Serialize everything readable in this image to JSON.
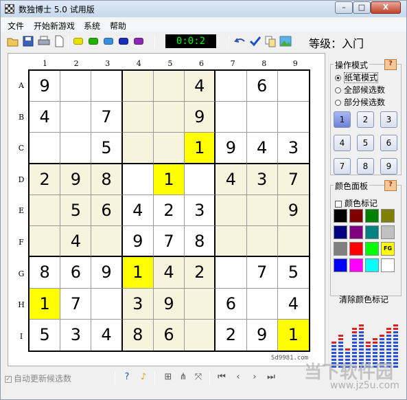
{
  "window": {
    "title": "数独博士 5.0 试用版",
    "min": "–",
    "max": "□",
    "close": "X"
  },
  "menu": [
    "文件",
    "开始新游戏",
    "系统",
    "帮助"
  ],
  "timer": "0:0:2",
  "level": "等级：入门",
  "board": {
    "cols": [
      "1",
      "2",
      "3",
      "4",
      "5",
      "6",
      "7",
      "8",
      "9"
    ],
    "rows": [
      "A",
      "B",
      "C",
      "D",
      "E",
      "F",
      "G",
      "H",
      "I"
    ],
    "cells": [
      [
        "9",
        "",
        "",
        "",
        "",
        "4",
        "",
        "6",
        ""
      ],
      [
        "4",
        "",
        "7",
        "",
        "",
        "9",
        "",
        "",
        ""
      ],
      [
        "",
        "",
        "5",
        "",
        "",
        "1",
        "9",
        "4",
        "3"
      ],
      [
        "2",
        "9",
        "8",
        "",
        "1",
        "",
        "4",
        "3",
        "7"
      ],
      [
        "",
        "5",
        "6",
        "4",
        "2",
        "3",
        "",
        "",
        "9"
      ],
      [
        "",
        "4",
        "",
        "9",
        "7",
        "8",
        "",
        "",
        ""
      ],
      [
        "8",
        "6",
        "9",
        "1",
        "4",
        "2",
        "",
        "7",
        "5"
      ],
      [
        "1",
        "7",
        "",
        "3",
        "9",
        "",
        "6",
        "",
        "4"
      ],
      [
        "5",
        "3",
        "4",
        "8",
        "6",
        "",
        "2",
        "9",
        "1"
      ]
    ],
    "highlighted": [
      "C6",
      "D5",
      "G4",
      "H1",
      "I9"
    ],
    "watermark": "Sd9981.com"
  },
  "mode_panel": {
    "title": "操作模式",
    "help": "?",
    "options": [
      "纸笔模式",
      "全部候选数",
      "部分候选数"
    ],
    "selected": 0,
    "numbers": [
      "1",
      "2",
      "3",
      "4",
      "5",
      "6",
      "7",
      "8",
      "9"
    ],
    "active_number": "1"
  },
  "color_panel": {
    "title": "颜色面板",
    "help": "?",
    "mark_label": "颜色标记",
    "swatches": [
      "#000000",
      "#800000",
      "#008000",
      "#808000",
      "#000080",
      "#800080",
      "#008080",
      "#c0c0c0",
      "#808080",
      "#ff0000",
      "#00ff00",
      "#ffff00",
      "#0000ff",
      "#ff00ff",
      "#00ffff",
      "#ffffff"
    ],
    "fg_label": "FG",
    "clear_label": "清除颜色标记"
  },
  "status": {
    "auto_update": "自动更新候选数"
  },
  "brand": {
    "name": "Sd9981.com",
    "logo_text": "当下软件园",
    "url": "www.jz5u.com"
  }
}
